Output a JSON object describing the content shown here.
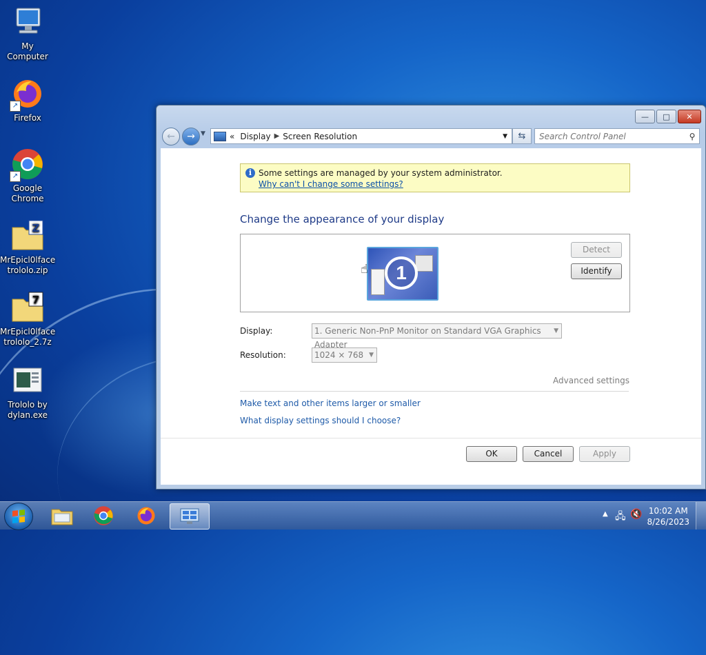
{
  "desktop": {
    "icons": [
      {
        "label": "My Computer",
        "icon": "computer-icon"
      },
      {
        "label": "Firefox",
        "icon": "firefox-icon"
      },
      {
        "label": "Google Chrome",
        "icon": "chrome-icon"
      },
      {
        "label": "MrEpicl0lface trololo.zip",
        "icon": "zip-folder-icon"
      },
      {
        "label": "MrEpicl0lface trololo_2.7z",
        "icon": "7z-archive-icon"
      },
      {
        "label": "Trololo by dylan.exe",
        "icon": "exe-icon"
      }
    ]
  },
  "window": {
    "buttons": {
      "minimize": "—",
      "maximize": "□",
      "close": "✕"
    },
    "address": {
      "chevrons": "«",
      "crumbs": [
        "Display",
        "Screen Resolution"
      ]
    },
    "search_placeholder": "Search Control Panel",
    "notice": {
      "text": "Some settings are managed by your system administrator.",
      "link": "Why can't I change some settings?"
    },
    "heading": "Change the appearance of your display",
    "preview": {
      "monitor_number": "1"
    },
    "detect_label": "Detect",
    "identify_label": "Identify",
    "display_label": "Display:",
    "display_value": "1. Generic Non-PnP Monitor on Standard VGA Graphics Adapter",
    "resolution_label": "Resolution:",
    "resolution_value": "1024 × 768",
    "advanced_label": "Advanced settings",
    "links": [
      "Make text and other items larger or smaller",
      "What display settings should I choose?"
    ],
    "ok_label": "OK",
    "cancel_label": "Cancel",
    "apply_label": "Apply"
  },
  "taskbar": {
    "pinned": [
      "explorer-icon",
      "chrome-icon",
      "firefox-icon",
      "display-settings-icon"
    ],
    "clock": {
      "time": "10:02 AM",
      "date": "8/26/2023"
    }
  },
  "colors": {
    "accent": "#1e3a87",
    "link": "#1e5aa8",
    "notice_bg": "#fcfcc4"
  }
}
